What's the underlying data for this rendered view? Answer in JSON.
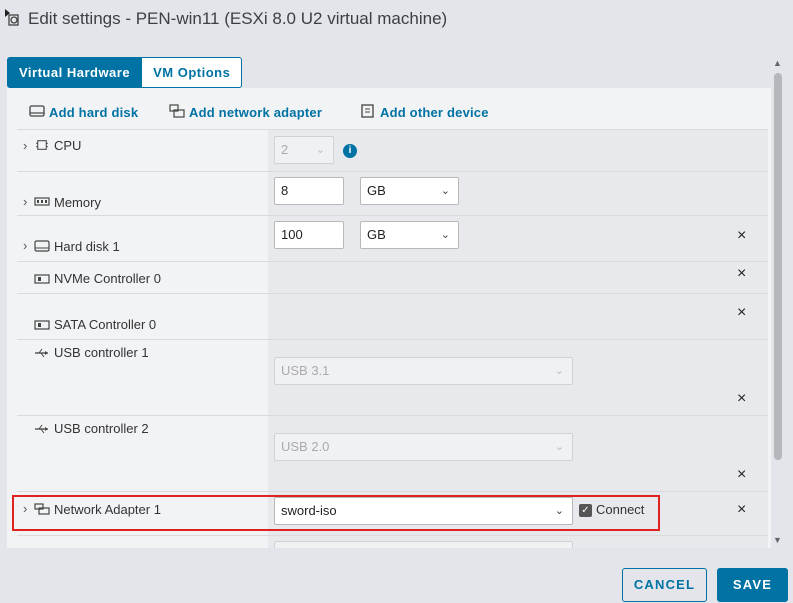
{
  "window": {
    "title": "Edit settings - PEN-win11 (ESXi 8.0 U2 virtual machine)"
  },
  "tabs": [
    {
      "label": "Virtual Hardware",
      "active": true
    },
    {
      "label": "VM Options",
      "active": false
    }
  ],
  "toolbar": {
    "add_hard_disk": "Add hard disk",
    "add_network_adapter": "Add network adapter",
    "add_other_device": "Add other device"
  },
  "hardware": {
    "cpu": {
      "label": "CPU",
      "value": "2",
      "icon": "cpu-icon"
    },
    "memory": {
      "label": "Memory",
      "value": "8",
      "unit": "GB",
      "icon": "memory-icon"
    },
    "hard_disk": {
      "label": "Hard disk 1",
      "value": "100",
      "unit": "GB",
      "icon": "hard-disk-icon"
    },
    "nvme": {
      "label": "NVMe Controller 0",
      "icon": "controller-icon"
    },
    "sata": {
      "label": "SATA Controller 0",
      "icon": "controller-icon"
    },
    "usb1": {
      "label": "USB controller 1",
      "value": "USB 3.1",
      "icon": "usb-icon"
    },
    "usb2": {
      "label": "USB controller 2",
      "value": "USB 2.0",
      "icon": "usb-icon"
    },
    "network": {
      "label": "Network Adapter 1",
      "value": "sword-iso",
      "connect_label": "Connect",
      "connected": true,
      "icon": "network-adapter-icon"
    }
  },
  "footer": {
    "cancel": "CANCEL",
    "save": "SAVE"
  },
  "colors": {
    "accent": "#0072a3",
    "highlight": "#e1211e"
  }
}
